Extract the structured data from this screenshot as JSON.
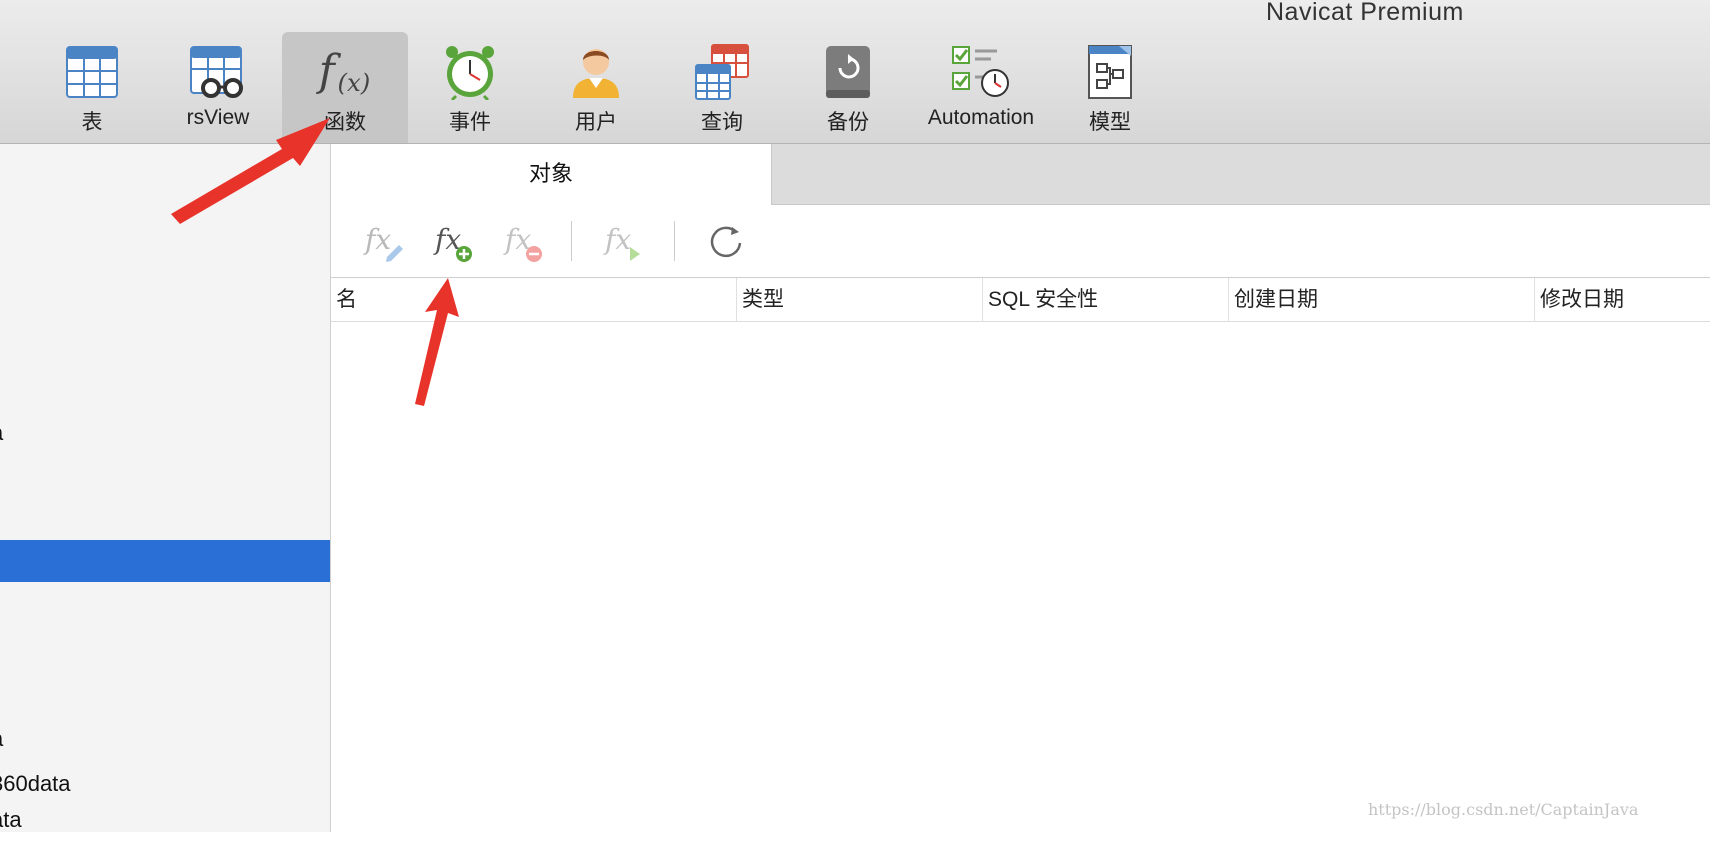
{
  "window": {
    "app_title": "Navicat Premium"
  },
  "toolbar": {
    "items": [
      {
        "label": "表",
        "icon": "table-icon"
      },
      {
        "label": "rsView",
        "icon": "view-icon"
      },
      {
        "label": "函数",
        "icon": "function-icon",
        "active": true
      },
      {
        "label": "事件",
        "icon": "event-clock-icon"
      },
      {
        "label": "用户",
        "icon": "user-icon"
      },
      {
        "label": "查询",
        "icon": "query-icon"
      },
      {
        "label": "备份",
        "icon": "backup-icon"
      },
      {
        "label": "Automation",
        "icon": "automation-icon"
      },
      {
        "label": "模型",
        "icon": "model-icon"
      }
    ]
  },
  "sidebar": {
    "items": [
      {
        "text": "a"
      },
      {
        "text": "",
        "selected": true
      },
      {
        "text": "a"
      },
      {
        "text": "360data"
      },
      {
        "text": "ata"
      }
    ]
  },
  "tabs": [
    {
      "label": "对象",
      "active": true
    }
  ],
  "object_toolbar": {
    "buttons": [
      {
        "icon": "edit-function-icon",
        "enabled": false
      },
      {
        "icon": "new-function-icon",
        "enabled": true
      },
      {
        "icon": "delete-function-icon",
        "enabled": false
      },
      {
        "icon": "run-function-icon",
        "enabled": false
      },
      {
        "icon": "refresh-icon",
        "enabled": true
      }
    ]
  },
  "table": {
    "columns": [
      "名",
      "类型",
      "SQL 安全性",
      "创建日期",
      "修改日期"
    ],
    "rows": []
  },
  "watermark": "https://blog.csdn.net/CaptainJava",
  "colors": {
    "selection": "#2a6fd6",
    "arrow": "#e8332a",
    "accent_green": "#5aa53b"
  }
}
